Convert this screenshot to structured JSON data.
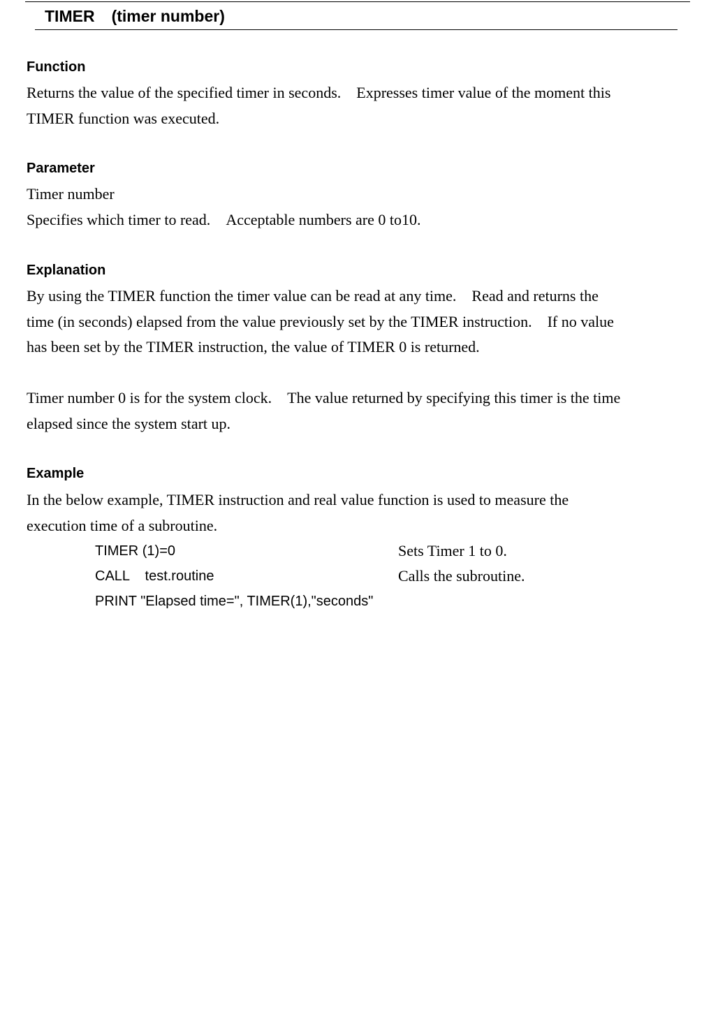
{
  "heading": {
    "keyword": "TIMER",
    "parameter": "(timer number)"
  },
  "function": {
    "title": "Function",
    "lines": [
      "Returns the value of the specified timer in seconds.",
      "Expresses timer value of the moment this",
      "TIMER function was executed."
    ]
  },
  "parameter": {
    "title": "Parameter",
    "name": "Timer number",
    "desc_a": "Specifies which timer to read.",
    "desc_b": "Acceptable numbers are 0 to10."
  },
  "explanation": {
    "title": "Explanation",
    "p1": {
      "l1a": "By using the TIMER function the timer value can be read at any time.",
      "l1b": "Read and returns the",
      "l2a": "time (in seconds) elapsed from the value previously set by the TIMER instruction.",
      "l2b": "If no value",
      "l3": "has been set by the TIMER instruction, the value of TIMER 0 is returned."
    },
    "p2": {
      "l1a": "Timer number 0 is for the system clock.",
      "l1b": "The value returned by specifying this timer is the time",
      "l2": "elapsed since the system start up."
    }
  },
  "example": {
    "title": "Example",
    "intro_l1": "In the below example, TIMER instruction and real value function is used to measure the",
    "intro_l2": "execution time of a subroutine.",
    "code": [
      {
        "code": "TIMER (1)=0",
        "comment": "Sets Timer 1 to 0."
      },
      {
        "code": "CALL    test.routine",
        "comment": "Calls the subroutine."
      },
      {
        "code": "PRINT \"Elapsed time=\", TIMER(1),\"seconds\"",
        "comment": ""
      }
    ]
  }
}
